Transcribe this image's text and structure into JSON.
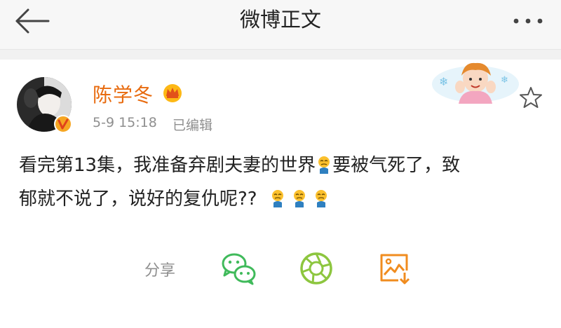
{
  "nav": {
    "title": "微博正文",
    "back_icon": "back-arrow-icon",
    "more_icon": "more-dots-icon"
  },
  "post": {
    "author": "陈学冬",
    "time": "5-9 15:18",
    "edited": "已编辑",
    "line1": "看完第13集，我准备弃剧夫妻的世界",
    "line1b": "要被气死了，致",
    "line2": "郁就不说了，说好的复仇呢??",
    "emoji_icon": "weary-emoji-icon"
  },
  "share": {
    "label": "分享",
    "targets": [
      "wechat-icon",
      "moments-icon",
      "save-image-icon"
    ]
  },
  "colors": {
    "username": "#e86b0f",
    "meta": "#8f8f8f",
    "share_green": "#40ba5b",
    "moments_green": "#8dc63f",
    "save_orange": "#f08c1f"
  }
}
